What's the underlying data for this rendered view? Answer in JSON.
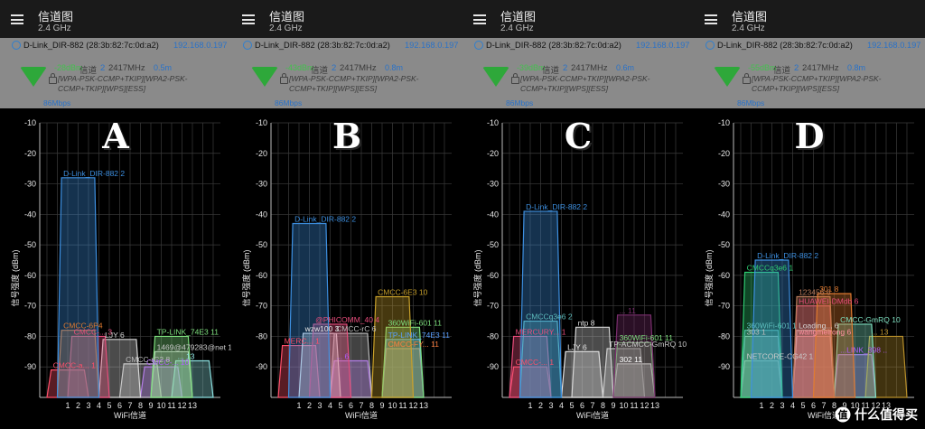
{
  "panels": [
    {
      "app_title": "信道图",
      "band": "2.4 GHz",
      "connected": {
        "ssid": "D-Link_DIR-882 (28:3b:82:7c:0d:a2)",
        "ip": "192.168.0.197",
        "level": "-28dBm",
        "channel_label": "信道",
        "channel": "2",
        "frequency": "2417MHz",
        "distance": "0.5m",
        "security": "[WPA-PSK-CCMP+TKIP][WPA2-PSK-CCMP+TKIP][WPS][ESS]",
        "rate": "86Mbps"
      },
      "badge": "A",
      "chart_data": {
        "type": "area",
        "xlabel": "WiFi信道",
        "ylabel": "信号强度 (dBm)",
        "x_ticks": [
          1,
          2,
          3,
          4,
          5,
          6,
          7,
          8,
          9,
          10,
          11,
          12,
          13
        ],
        "y_ticks": [
          -10,
          -20,
          -30,
          -40,
          -50,
          -60,
          -70,
          -80,
          -90
        ],
        "ylim": [
          -100,
          -10
        ],
        "series": [
          {
            "name": "D-Link_DIR-882 2",
            "channel": 2,
            "level": -28,
            "color": "#3d8fe0"
          },
          {
            "name": "CMCC-6P4",
            "channel": 2,
            "level": -78,
            "color": "#e07a2f"
          },
          {
            "name": "CMCC-... 3",
            "channel": 3,
            "level": -80,
            "color": "#e94d7c"
          },
          {
            "name": "LJY 6",
            "channel": 6,
            "level": -81,
            "color": "#d8d8d8"
          },
          {
            "name": "TP-LINK_74E3 11",
            "channel": 11,
            "level": -80,
            "color": "#7ee07e"
          },
          {
            "name": "1469@479283@net 11",
            "channel": 11,
            "level": -85,
            "color": "#c9c9c9"
          },
          {
            "name": "CMCC-... 10",
            "channel": 10,
            "level": -90,
            "color": "#b05cff"
          },
          {
            "name": "CMCC-rC2 8",
            "channel": 8,
            "level": -89,
            "color": "#bdbdbd"
          },
          {
            "name": "CMCC-a... 1",
            "channel": 1,
            "level": -91,
            "color": "#ff4f6a"
          },
          {
            "name": "... 13",
            "channel": 13,
            "level": -88,
            "color": "#8be0e0"
          }
        ]
      }
    },
    {
      "app_title": "信道图",
      "band": "2.4 GHz",
      "connected": {
        "ssid": "D-Link_DIR-882 (28:3b:82:7c:0d:a2)",
        "ip": "192.168.0.197",
        "level": "-43dBm",
        "channel_label": "信道",
        "channel": "2",
        "frequency": "2417MHz",
        "distance": "0.8m",
        "security": "[WPA-PSK-CCMP+TKIP][WPA2-PSK-CCMP+TKIP][WPS][ESS]",
        "rate": "86Mbps"
      },
      "badge": "B",
      "chart_data": {
        "type": "area",
        "xlabel": "WiFi信道",
        "ylabel": "信号强度 (dBm)",
        "x_ticks": [
          1,
          2,
          3,
          4,
          5,
          6,
          7,
          8,
          9,
          10,
          11,
          12,
          13
        ],
        "y_ticks": [
          -10,
          -20,
          -30,
          -40,
          -50,
          -60,
          -70,
          -80,
          -90
        ],
        "ylim": [
          -100,
          -10
        ],
        "series": [
          {
            "name": "D-Link_DIR-882 2",
            "channel": 2,
            "level": -43,
            "color": "#3d8fe0"
          },
          {
            "name": "CMCC-6E3 10",
            "channel": 10,
            "level": -67,
            "color": "#c8a02a"
          },
          {
            "name": "@PHICOMM_40 4",
            "channel": 4,
            "level": -76,
            "color": "#e94d7c"
          },
          {
            "name": "360WiFi-601 11",
            "channel": 11,
            "level": -77,
            "color": "#7ee07e"
          },
          {
            "name": "wzw100 3",
            "channel": 3,
            "level": -79,
            "color": "#e8e8e8"
          },
          {
            "name": "CMCC-rC 6",
            "channel": 6,
            "level": -79,
            "color": "#bdbdbd"
          },
          {
            "name": "TP-LINK_74E3 11",
            "channel": 11,
            "level": -81,
            "color": "#5a9fff"
          },
          {
            "name": "MERC... 1",
            "channel": 1,
            "level": -83,
            "color": "#ff4f6a"
          },
          {
            "name": "CMCC-FY... 11",
            "channel": 11,
            "level": -84,
            "color": "#ff7f3f"
          },
          {
            "name": "... 6",
            "channel": 6,
            "level": -88,
            "color": "#b05cff"
          }
        ]
      }
    },
    {
      "app_title": "信道图",
      "band": "2.4 GHz",
      "connected": {
        "ssid": "D-Link_DIR-882 (28:3b:82:7c:0d:a2)",
        "ip": "192.168.0.197",
        "level": "-39dBm",
        "channel_label": "信道",
        "channel": "2",
        "frequency": "2417MHz",
        "distance": "0.6m",
        "security": "[WPA-PSK-CCMP+TKIP][WPA2-PSK-CCMP+TKIP][WPS][ESS]",
        "rate": "86Mbps"
      },
      "badge": "C",
      "chart_data": {
        "type": "area",
        "xlabel": "WiFi信道",
        "ylabel": "信号强度 (dBm)",
        "x_ticks": [
          1,
          2,
          3,
          4,
          5,
          6,
          7,
          8,
          9,
          10,
          11,
          12,
          13
        ],
        "y_ticks": [
          -10,
          -20,
          -30,
          -40,
          -50,
          -60,
          -70,
          -80,
          -90
        ],
        "ylim": [
          -100,
          -10
        ],
        "series": [
          {
            "name": "D-Link_DIR-882 2",
            "channel": 2,
            "level": -39,
            "color": "#3d8fe0"
          },
          {
            "name": "CMCCq3e6 2",
            "channel": 2,
            "level": -75,
            "color": "#5fbfbf"
          },
          {
            "name": "ntp 8",
            "channel": 7,
            "level": -77,
            "color": "#d8d8d8"
          },
          {
            "name": "MERCURY... 1",
            "channel": 1,
            "level": -80,
            "color": "#e94d7c"
          },
          {
            "name": "... 11",
            "channel": 11,
            "level": -73,
            "color": "#7a2e6e"
          },
          {
            "name": "360WiFi-601 11",
            "channel": 11,
            "level": -82,
            "color": "#7ee07e"
          },
          {
            "name": "TP-ACMCC-GmRQ 10",
            "channel": 10,
            "level": -84,
            "color": "#c9c9c9"
          },
          {
            "name": "LJY 6",
            "channel": 6,
            "level": -85,
            "color": "#e8e8e8"
          },
          {
            "name": "302 11",
            "channel": 11,
            "level": -89,
            "color": "#ffffff"
          },
          {
            "name": "CMCC-... 1",
            "channel": 1,
            "level": -90,
            "color": "#ff4f6a"
          }
        ]
      }
    },
    {
      "app_title": "信道图",
      "band": "2.4 GHz",
      "connected": {
        "ssid": "D-Link_DIR-882 (28:3b:82:7c:0d:a2)",
        "ip": "192.168.0.197",
        "level": "-55dBm",
        "channel_label": "信道",
        "channel": "2",
        "frequency": "2417MHz",
        "distance": "0.8m",
        "security": "[WPA-PSK-CCMP+TKIP][WPA2-PSK-CCMP+TKIP][WPS][ESS]",
        "rate": "86Mbps"
      },
      "badge": "D",
      "chart_data": {
        "type": "area",
        "xlabel": "WiFi信道",
        "ylabel": "信号强度 (dBm)",
        "x_ticks": [
          1,
          2,
          3,
          4,
          5,
          6,
          7,
          8,
          9,
          10,
          11,
          12,
          13
        ],
        "y_ticks": [
          -10,
          -20,
          -30,
          -40,
          -50,
          -60,
          -70,
          -80,
          -90
        ],
        "ylim": [
          -100,
          -10
        ],
        "series": [
          {
            "name": "D-Link_DIR-882 2",
            "channel": 2,
            "level": -55,
            "color": "#3d8fe0"
          },
          {
            "name": "CMCCq3e6 1",
            "channel": 1,
            "level": -59,
            "color": "#2ecc71"
          },
          {
            "name": "123456 6",
            "channel": 6,
            "level": -67,
            "color": "#b87a5a"
          },
          {
            "name": "301 8",
            "channel": 8,
            "level": -66,
            "color": "#e07a2f"
          },
          {
            "name": "HUAWEI-DMdb 6",
            "channel": 6,
            "level": -70,
            "color": "#e94d7c"
          },
          {
            "name": "CMCC-GmRQ 10",
            "channel": 10,
            "level": -76,
            "color": "#7ee0c0"
          },
          {
            "name": "Loading... 6",
            "channel": 6,
            "level": -78,
            "color": "#d8d8d8"
          },
          {
            "name": "wangmeirong 6",
            "channel": 6,
            "level": -80,
            "color": "#ff8fa0"
          },
          {
            "name": "360WiFi-601 1",
            "channel": 1,
            "level": -78,
            "color": "#5fbfbf"
          },
          {
            "name": "303 1",
            "channel": 1,
            "level": -80,
            "color": "#bdbdbd"
          },
          {
            "name": "NETCORE-CG42 1",
            "channel": 1,
            "level": -88,
            "color": "#c9c9c9"
          },
          {
            "name": "...LINK_398 ..",
            "channel": 10,
            "level": -86,
            "color": "#b05cff"
          },
          {
            "name": "... 13",
            "channel": 13,
            "level": -80,
            "color": "#b88f2a"
          }
        ]
      }
    }
  ],
  "watermark": {
    "site_name": "什么值得买"
  }
}
